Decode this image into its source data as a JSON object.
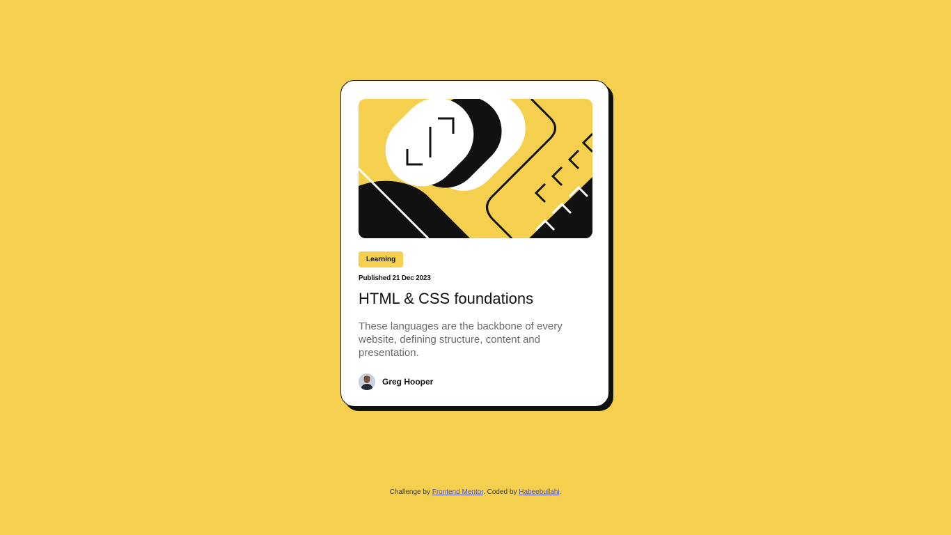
{
  "card": {
    "tag": "Learning",
    "published": "Published 21 Dec 2023",
    "title": "HTML & CSS foundations",
    "description": "These languages are the backbone of every website, defining structure, content and presentation.",
    "author": {
      "name": "Greg Hooper",
      "avatar_icon": "avatar-photo"
    },
    "illustration_icon": "code-illustration"
  },
  "attribution": {
    "prefix": "Challenge by ",
    "link1": "Frontend Mentor",
    "middle": ". Coded by ",
    "link2": "Habeebullahi",
    "suffix": "."
  },
  "colors": {
    "background": "#F4D04E",
    "ink": "#111111",
    "card": "#FFFFFF",
    "muted_text": "#6B6B6B",
    "link": "#4A4FB5"
  }
}
